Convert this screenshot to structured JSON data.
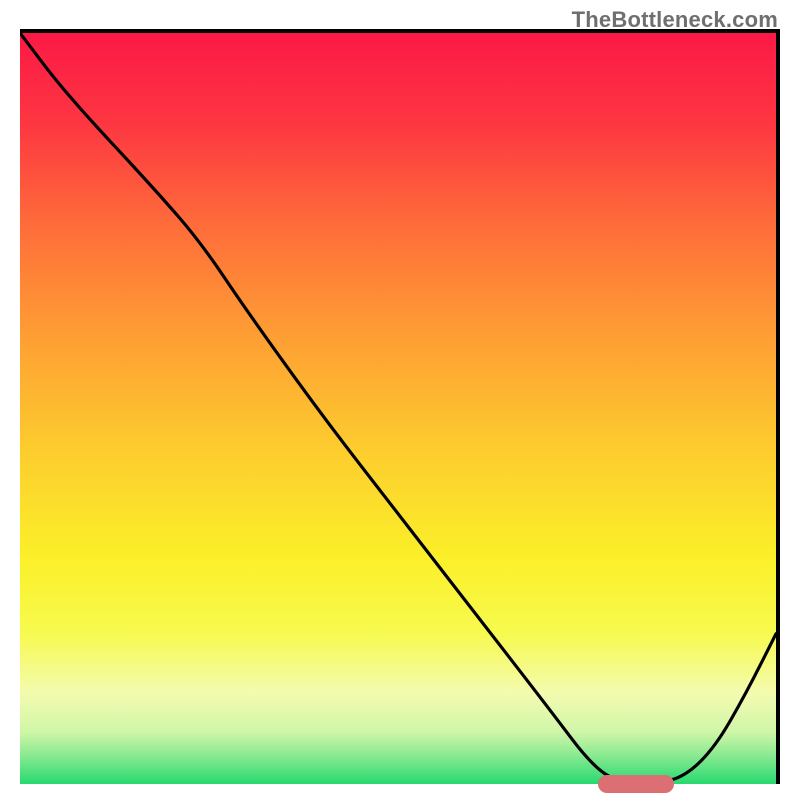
{
  "watermark": "TheBottleneck.com",
  "chart_data": {
    "type": "line",
    "title": "",
    "xlabel": "",
    "ylabel": "",
    "xlim": [
      0,
      100
    ],
    "ylim": [
      0,
      100
    ],
    "series": [
      {
        "name": "bottleneck-curve",
        "x": [
          0,
          6,
          18,
          24,
          30,
          40,
          50,
          60,
          70,
          76,
          80,
          84,
          88,
          92,
          96,
          100
        ],
        "y": [
          100,
          92,
          79,
          72,
          63,
          49,
          36,
          23,
          10,
          2,
          0,
          0,
          1,
          5,
          12,
          20
        ]
      }
    ],
    "marker": {
      "x_start": 76,
      "x_end": 86,
      "y": 0
    },
    "gradient_stops": [
      {
        "pct": 0,
        "color": "#fb1946"
      },
      {
        "pct": 12,
        "color": "#fd3641"
      },
      {
        "pct": 25,
        "color": "#fe6a3a"
      },
      {
        "pct": 40,
        "color": "#fe9d34"
      },
      {
        "pct": 55,
        "color": "#fdcb2e"
      },
      {
        "pct": 70,
        "color": "#fbf029"
      },
      {
        "pct": 80,
        "color": "#f7fa4f"
      },
      {
        "pct": 88,
        "color": "#f3fbb0"
      },
      {
        "pct": 93,
        "color": "#d0f6a8"
      },
      {
        "pct": 96,
        "color": "#8eeb93"
      },
      {
        "pct": 100,
        "color": "#27d96f"
      }
    ]
  }
}
